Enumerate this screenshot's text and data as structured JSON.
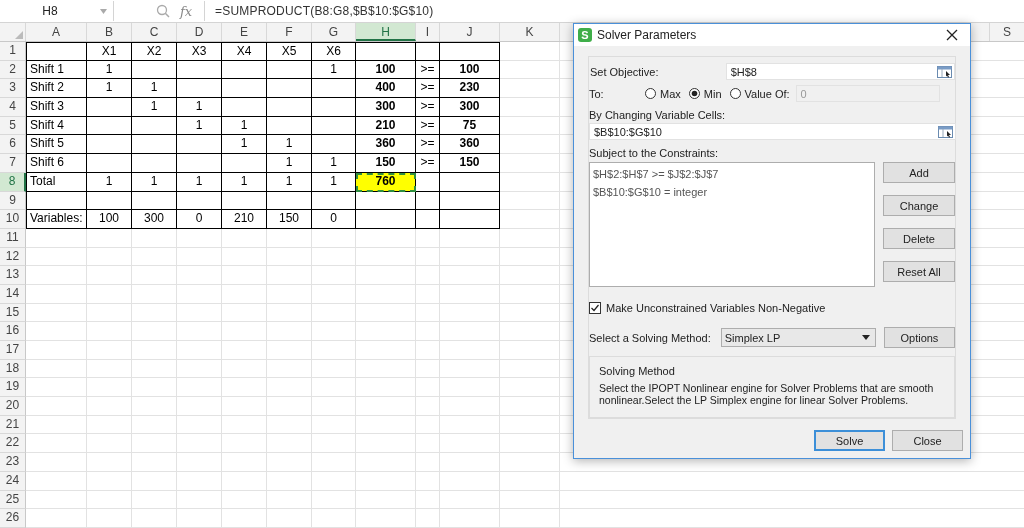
{
  "name_box": {
    "value": "H8"
  },
  "formula_bar": {
    "fx": "fx",
    "formula": "=SUMPRODUCT(B8:G8,$B$10:$G$10)"
  },
  "columns": [
    {
      "label": "A",
      "selected": false
    },
    {
      "label": "B",
      "selected": false
    },
    {
      "label": "C",
      "selected": false
    },
    {
      "label": "D",
      "selected": false
    },
    {
      "label": "E",
      "selected": false
    },
    {
      "label": "F",
      "selected": false
    },
    {
      "label": "G",
      "selected": false
    },
    {
      "label": "H",
      "selected": true
    },
    {
      "label": "I",
      "selected": false
    },
    {
      "label": "J",
      "selected": false
    },
    {
      "label": "K",
      "selected": false
    }
  ],
  "far_column": {
    "label": "S"
  },
  "table_rows": [
    {
      "number": "1",
      "selected": false,
      "cells": {
        "B": {
          "text": "X1"
        },
        "C": {
          "text": "X2"
        },
        "D": {
          "text": "X3"
        },
        "E": {
          "text": "X4"
        },
        "F": {
          "text": "X5"
        },
        "G": {
          "text": "X6"
        }
      }
    },
    {
      "number": "2",
      "selected": false,
      "cells": {
        "A": {
          "text": "Shift 1"
        },
        "B": {
          "text": "1"
        },
        "G": {
          "text": "1"
        },
        "H": {
          "text": "100",
          "bold": true
        },
        "I": {
          "text": ">="
        },
        "J": {
          "text": "100",
          "bold": true
        }
      }
    },
    {
      "number": "3",
      "selected": false,
      "cells": {
        "A": {
          "text": "Shift 2"
        },
        "B": {
          "text": "1"
        },
        "C": {
          "text": "1"
        },
        "H": {
          "text": "400",
          "bold": true
        },
        "I": {
          "text": ">="
        },
        "J": {
          "text": "230",
          "bold": true
        }
      }
    },
    {
      "number": "4",
      "selected": false,
      "cells": {
        "A": {
          "text": "Shift 3"
        },
        "C": {
          "text": "1"
        },
        "D": {
          "text": "1"
        },
        "H": {
          "text": "300",
          "bold": true
        },
        "I": {
          "text": ">="
        },
        "J": {
          "text": "300",
          "bold": true
        }
      }
    },
    {
      "number": "5",
      "selected": false,
      "cells": {
        "A": {
          "text": "Shift 4"
        },
        "D": {
          "text": "1"
        },
        "E": {
          "text": "1"
        },
        "H": {
          "text": "210",
          "bold": true
        },
        "I": {
          "text": ">="
        },
        "J": {
          "text": "75",
          "bold": true
        }
      }
    },
    {
      "number": "6",
      "selected": false,
      "cells": {
        "A": {
          "text": "Shift 5"
        },
        "E": {
          "text": "1"
        },
        "F": {
          "text": "1"
        },
        "H": {
          "text": "360",
          "bold": true
        },
        "I": {
          "text": ">="
        },
        "J": {
          "text": "360",
          "bold": true
        }
      }
    },
    {
      "number": "7",
      "selected": false,
      "cells": {
        "A": {
          "text": "Shift 6"
        },
        "F": {
          "text": "1"
        },
        "G": {
          "text": "1"
        },
        "H": {
          "text": "150",
          "bold": true
        },
        "I": {
          "text": ">="
        },
        "J": {
          "text": "150",
          "bold": true
        }
      }
    },
    {
      "number": "8",
      "selected": true,
      "cells": {
        "A": {
          "text": "Total"
        },
        "B": {
          "text": "1"
        },
        "C": {
          "text": "1"
        },
        "D": {
          "text": "1"
        },
        "E": {
          "text": "1"
        },
        "F": {
          "text": "1"
        },
        "G": {
          "text": "1"
        },
        "H": {
          "text": "760",
          "bold": true,
          "highlighted": true,
          "selected": true
        }
      }
    },
    {
      "number": "9",
      "selected": false
    },
    {
      "number": "10",
      "selected": false,
      "cells": {
        "A": {
          "text": "Variables:"
        },
        "B": {
          "text": "100"
        },
        "C": {
          "text": "300"
        },
        "D": {
          "text": "0"
        },
        "E": {
          "text": "210"
        },
        "F": {
          "text": "150"
        },
        "G": {
          "text": "0"
        }
      }
    }
  ],
  "more_rows": [
    {
      "number": "11",
      "selected": false
    },
    {
      "number": "12",
      "selected": false
    },
    {
      "number": "13",
      "selected": false
    },
    {
      "number": "14",
      "selected": false
    },
    {
      "number": "15",
      "selected": false
    },
    {
      "number": "16",
      "selected": false
    },
    {
      "number": "17",
      "selected": false
    },
    {
      "number": "18",
      "selected": false
    },
    {
      "number": "19",
      "selected": false
    },
    {
      "number": "20",
      "selected": false
    },
    {
      "number": "21",
      "selected": false
    },
    {
      "number": "22",
      "selected": false
    },
    {
      "number": "23",
      "selected": false
    },
    {
      "number": "24",
      "selected": false
    },
    {
      "number": "25",
      "selected": false
    },
    {
      "number": "26",
      "selected": false
    }
  ],
  "dialog": {
    "logo": "S",
    "title": "Solver Parameters",
    "objective": {
      "label": "Set Objective:",
      "value": "$H$8"
    },
    "to": {
      "label": "To:",
      "options": [
        {
          "label": "Max",
          "selected": false
        },
        {
          "label": "Min",
          "selected": true
        },
        {
          "label": "Value Of:",
          "selected": false
        }
      ],
      "value_field": {
        "value": "0",
        "disabled": true
      }
    },
    "variables": {
      "label": "By Changing Variable Cells:",
      "value": "$B$10:$G$10"
    },
    "constraints": {
      "label": "Subject to the Constraints:",
      "items": [
        "$H$2:$H$7 >= $J$2:$J$7",
        "$B$10:$G$10 = integer"
      ]
    },
    "side_buttons": [
      "Add",
      "Change",
      "Delete",
      "Reset All"
    ],
    "nonnegative": {
      "label": "Make Unconstrained Variables Non-Negative",
      "checked": true
    },
    "method": {
      "label": "Select a Solving Method:",
      "value": "Simplex LP",
      "button": "Options"
    },
    "description": {
      "title": "Solving Method",
      "text": "Select the IPOPT Nonlinear engine for Solver Problems that are smooth nonlinear.Select the LP Simplex engine for linear Solver Problems."
    },
    "footer_buttons": [
      {
        "label": "Solve",
        "default": true
      },
      {
        "label": "Close",
        "default": false
      }
    ]
  }
}
